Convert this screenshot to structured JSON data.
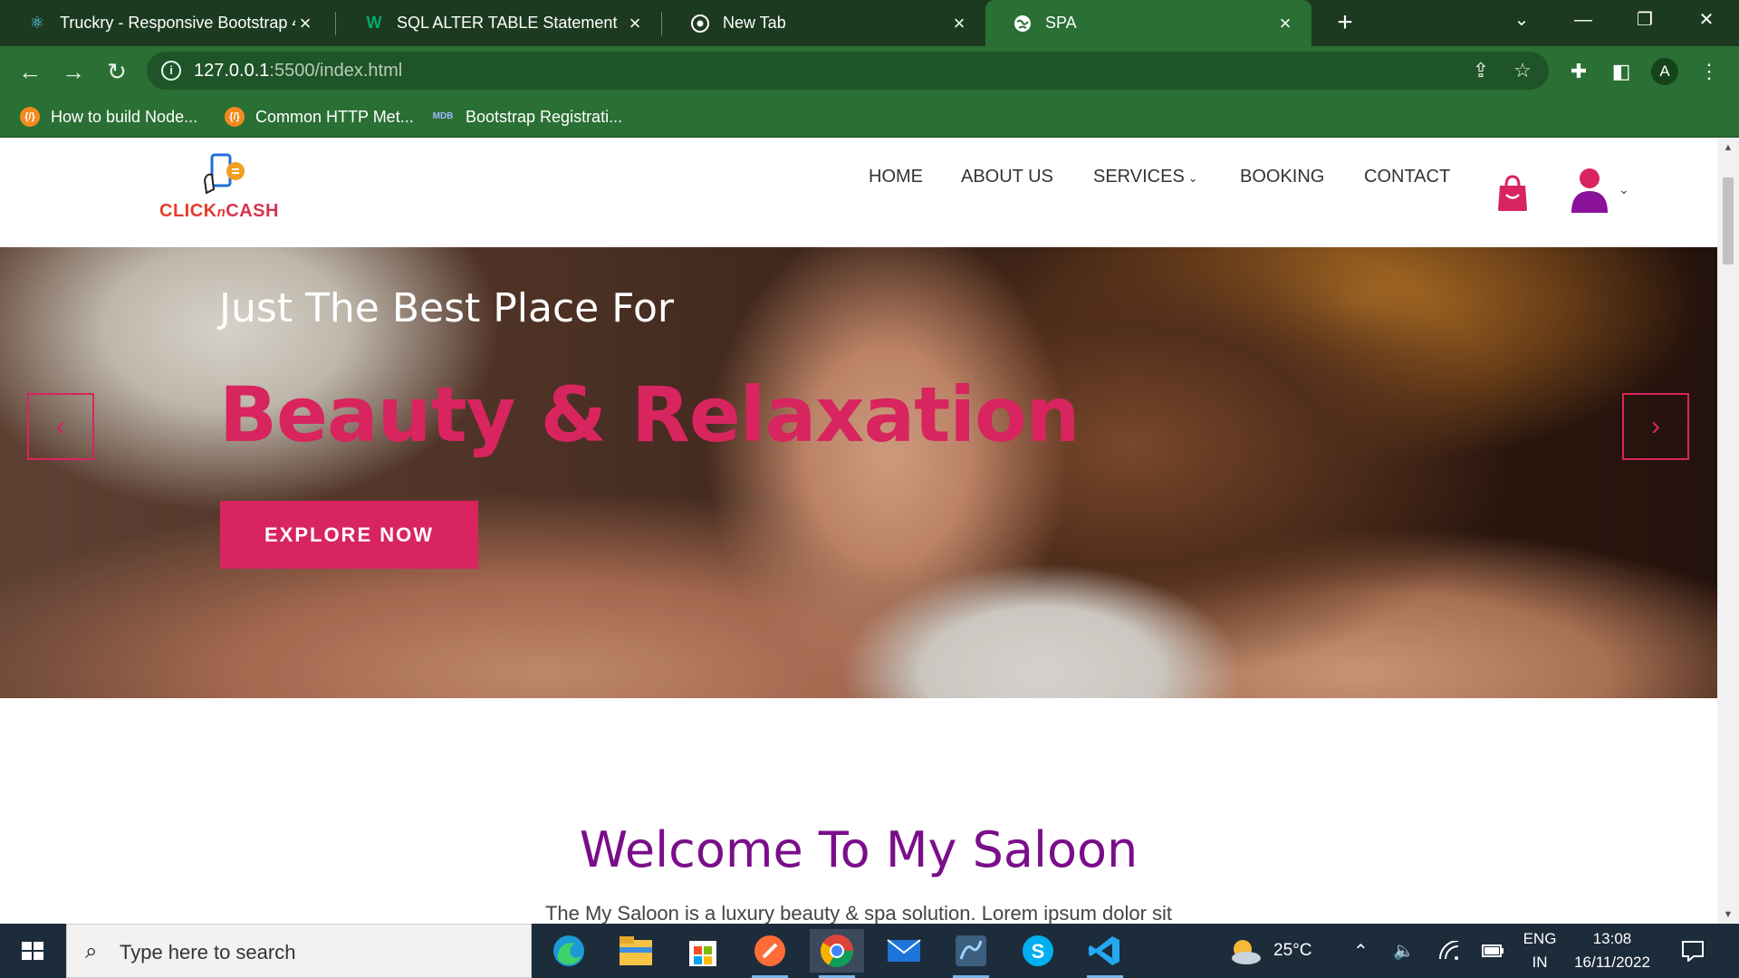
{
  "browser": {
    "tabs": [
      {
        "title": "Truckry - Responsive Bootstrap 4",
        "icon": "react-icon"
      },
      {
        "title": "SQL ALTER TABLE Statement",
        "icon": "w3schools-icon"
      },
      {
        "title": "New Tab",
        "icon": "chrome-icon"
      },
      {
        "title": "SPA",
        "icon": "globe-icon"
      }
    ],
    "address": {
      "host": "127.0.0.1",
      "rest": ":5500/index.html"
    },
    "profile_initial": "A",
    "bookmarks": [
      {
        "label": "How to build Node...",
        "icon": "{/}"
      },
      {
        "label": "Common HTTP Met...",
        "icon": "{/}"
      },
      {
        "label": "Bootstrap Registrati...",
        "icon": "MDB"
      }
    ]
  },
  "site": {
    "logo": {
      "part1": "CLICK",
      "part2": "n",
      "part3": "CASH"
    },
    "nav": {
      "home": "HOME",
      "about": "ABOUT US",
      "services": "SERVICES",
      "booking": "BOOKING",
      "contact": "CONTACT"
    },
    "hero": {
      "kicker": "Just The Best Place For",
      "headline": "Beauty & Relaxation",
      "cta": "EXPLORE NOW"
    },
    "welcome": {
      "title": "Welcome To My Saloon",
      "text": "The My Saloon is a luxury beauty & spa solution. Lorem ipsum dolor sit"
    },
    "colors": {
      "accent": "#d8245f",
      "heading": "#7a0e8a",
      "chrome": "#2a6f34"
    }
  },
  "taskbar": {
    "search_placeholder": "Type here to search",
    "weather": "25°C",
    "lang_top": "ENG",
    "lang_bottom": "IN",
    "time": "13:08",
    "date": "16/11/2022"
  }
}
